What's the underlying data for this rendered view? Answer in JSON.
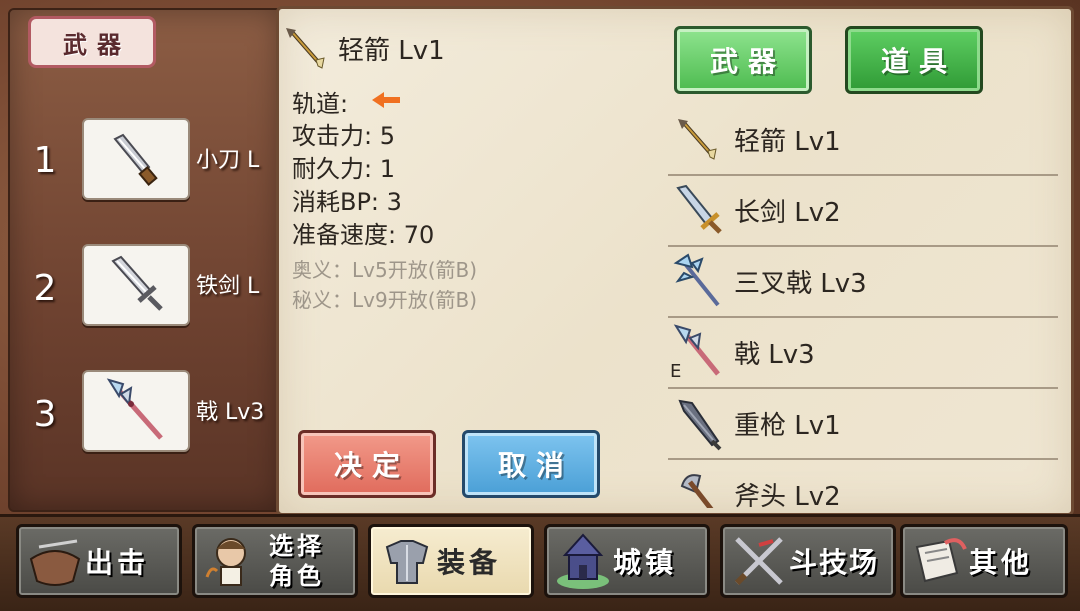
{
  "left_panel": {
    "title": "武器",
    "slots": [
      {
        "number": "1",
        "label": "小刀 L",
        "icon": "knife-icon"
      },
      {
        "number": "2",
        "label": "铁剑 L",
        "icon": "iron-sword-icon"
      },
      {
        "number": "3",
        "label": "戟 Lv3",
        "icon": "halberd-icon"
      }
    ]
  },
  "detail": {
    "name": "轻箭 Lv1",
    "trajectory_label": "轨道:",
    "trajectory_icon": "left-arrow-icon",
    "attack": "攻击力: 5",
    "durability": "耐久力: 1",
    "bp_cost": "消耗BP: 3",
    "prep_speed": "准备速度: 70",
    "secret1": "奥义：Lv5开放(箭B)",
    "secret2": "秘义：Lv9开放(箭B)"
  },
  "tabs": {
    "weapon": "武器",
    "item": "道具"
  },
  "actions": {
    "confirm": "决定",
    "cancel": "取消"
  },
  "weapon_list": [
    {
      "label": "轻箭 Lv1",
      "icon": "arrow-icon"
    },
    {
      "label": "长剑 Lv2",
      "icon": "long-sword-icon"
    },
    {
      "label": "三叉戟 Lv3",
      "icon": "trident-icon"
    },
    {
      "label": "戟 Lv3",
      "icon": "halberd-icon",
      "badge": "E"
    },
    {
      "label": "重枪 Lv1",
      "icon": "heavy-lance-icon"
    },
    {
      "label": "斧头 Lv2",
      "icon": "axe-icon"
    }
  ],
  "bottom_nav": [
    {
      "label": "出击",
      "icon": "sortie-icon"
    },
    {
      "label_line1": "选择",
      "label_line2": "角色",
      "icon": "character-icon"
    },
    {
      "label": "装备",
      "icon": "armor-icon",
      "active": true
    },
    {
      "label": "城镇",
      "icon": "castle-icon"
    },
    {
      "label": "斗技场",
      "icon": "arena-icon"
    },
    {
      "label": "其他",
      "icon": "scroll-icon"
    }
  ],
  "colors": {
    "accent_green": "#4dbb4f",
    "confirm_red": "#e06b5c",
    "cancel_blue": "#4a9fd6",
    "trajectory_orange": "#f07020"
  }
}
